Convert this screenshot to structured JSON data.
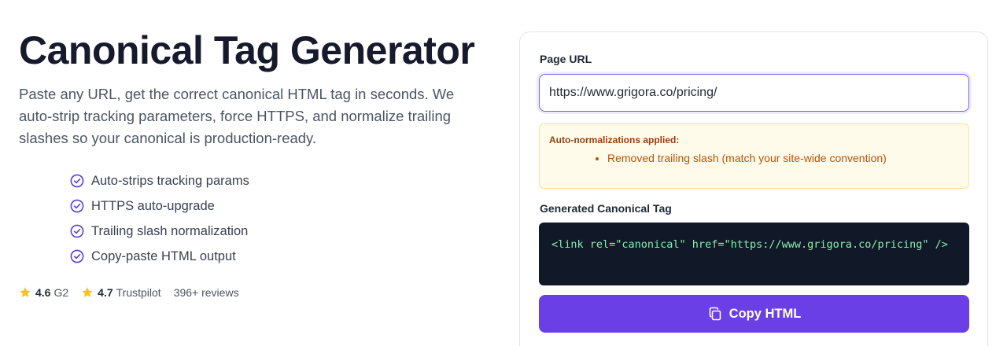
{
  "hero": {
    "title": "Canonical Tag Generator",
    "subtitle": "Paste any URL, get the correct canonical HTML tag in seconds. We auto-strip tracking parameters, force HTTPS, and normalize trailing slashes so your canonical is production-ready."
  },
  "features": [
    "Auto-strips tracking params",
    "HTTPS auto-upgrade",
    "Trailing slash normalization",
    "Copy-paste HTML output"
  ],
  "ratings": {
    "g2": {
      "score": "4.6",
      "source": "G2"
    },
    "trustpilot": {
      "score": "4.7",
      "source": "Trustpilot"
    },
    "reviews": "396+ reviews"
  },
  "form": {
    "url_label": "Page URL",
    "url_value": "https://www.grigora.co/pricing/",
    "notice_title": "Auto-normalizations applied:",
    "notice_items": [
      "Removed trailing slash (match your site-wide convention)"
    ],
    "output_label": "Generated Canonical Tag",
    "output_code": "<link rel=\"canonical\" href=\"https://www.grigora.co/pricing\" />",
    "copy_label": "Copy HTML"
  },
  "colors": {
    "accent": "#6a3fe6",
    "check": "#5b3fd6",
    "star": "#f5c518",
    "notice_bg": "#fffbeb",
    "code_bg": "#111827",
    "code_text": "#86efac"
  },
  "icons": {
    "feature": "check-circle-icon",
    "rating": "star-icon",
    "copy": "copy-icon"
  }
}
